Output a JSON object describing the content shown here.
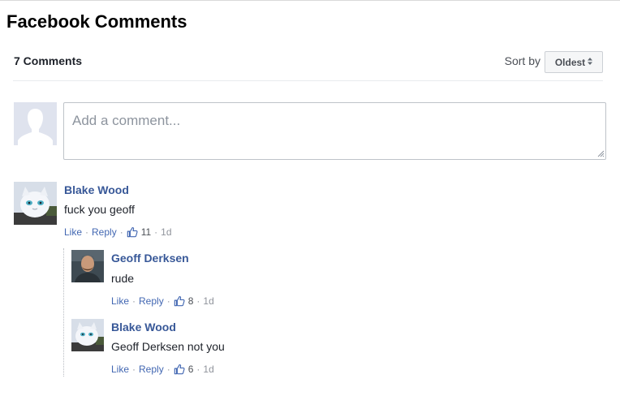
{
  "page": {
    "title": "Facebook Comments"
  },
  "header": {
    "count": "7 Comments",
    "sort_label": "Sort by",
    "sort_value": "Oldest",
    "sort_arrows": "▲▼"
  },
  "composer": {
    "placeholder": "Add a comment..."
  },
  "comments": [
    {
      "author": "Blake Wood",
      "text": "fuck you geoff",
      "like": "Like",
      "reply": "Reply",
      "likes": "11",
      "time": "1d",
      "replies": [
        {
          "author": "Geoff Derksen",
          "text": "rude",
          "like": "Like",
          "reply": "Reply",
          "likes": "8",
          "time": "1d"
        },
        {
          "author": "Blake Wood",
          "text": "Geoff Derksen not you",
          "like": "Like",
          "reply": "Reply",
          "likes": "6",
          "time": "1d"
        }
      ]
    }
  ],
  "colors": {
    "link": "#4267b2",
    "author": "#385898",
    "meta": "#90949c"
  },
  "icons": {
    "like": "thumbs-up-icon",
    "sort": "sort-arrows-icon",
    "default_avatar": "default-avatar-icon"
  }
}
